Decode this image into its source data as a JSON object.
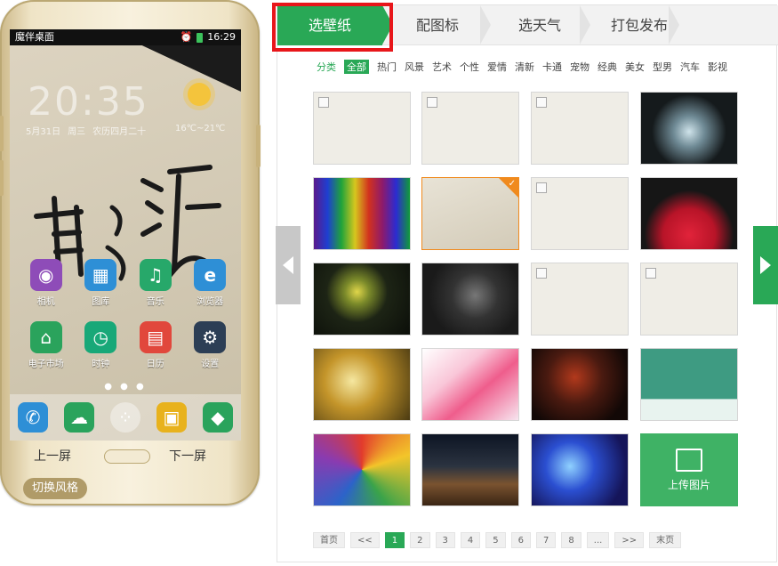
{
  "phone": {
    "status_title": "魔伴桌面",
    "status_time": "16:29",
    "clock": "20:35",
    "date_parts": [
      "5月31日",
      "周三",
      "农历四月二十"
    ],
    "temperature": "16℃~21℃",
    "apps": [
      {
        "label": "相机",
        "icon": "camera-icon",
        "color": "#8e4cb8",
        "glyph": "◉"
      },
      {
        "label": "图库",
        "icon": "gallery-icon",
        "color": "#2e8fd6",
        "glyph": "▦"
      },
      {
        "label": "音乐",
        "icon": "music-icon",
        "color": "#27a86a",
        "glyph": "♫"
      },
      {
        "label": "浏览器",
        "icon": "browser-icon",
        "color": "#2e8fd6",
        "glyph": "e"
      },
      {
        "label": "电子市场",
        "icon": "market-icon",
        "color": "#2aa35c",
        "glyph": "⌂"
      },
      {
        "label": "时钟",
        "icon": "alarm-clock-icon",
        "color": "#18a878",
        "glyph": "◷"
      },
      {
        "label": "日历",
        "icon": "calendar-icon",
        "color": "#e1473c",
        "glyph": "▤"
      },
      {
        "label": "设置",
        "icon": "settings-icon",
        "color": "#2c3e55",
        "glyph": "⚙"
      }
    ],
    "dock": [
      {
        "icon": "phone-icon",
        "color": "#2e8fd6",
        "glyph": "✆"
      },
      {
        "icon": "message-icon",
        "color": "#2aa35c",
        "glyph": "☁"
      },
      {
        "icon": "app-drawer-icon",
        "color": "rgba(255,255,255,0.4)",
        "glyph": "⁘"
      },
      {
        "icon": "contacts-icon",
        "color": "#e8b21d",
        "glyph": "▣"
      },
      {
        "icon": "theme-icon",
        "color": "#2aa35c",
        "glyph": "◆"
      }
    ],
    "prev_label": "上一屏",
    "next_label": "下一屏",
    "switch_style": "切换风格"
  },
  "steps": [
    {
      "label": "选壁纸",
      "active": true
    },
    {
      "label": "配图标",
      "active": false
    },
    {
      "label": "选天气",
      "active": false
    },
    {
      "label": "打包发布",
      "active": false
    }
  ],
  "filters": {
    "label": "分类",
    "items": [
      "全部",
      "热门",
      "风景",
      "艺术",
      "个性",
      "爱情",
      "清新",
      "卡通",
      "宠物",
      "经典",
      "美女",
      "型男",
      "汽车",
      "影视"
    ],
    "selected": "全部"
  },
  "wallpapers": [
    {
      "kind": "placeholder"
    },
    {
      "kind": "placeholder"
    },
    {
      "kind": "placeholder"
    },
    {
      "kind": "bottles"
    },
    {
      "kind": "spectrum"
    },
    {
      "kind": "calligraphy",
      "selected": true
    },
    {
      "kind": "placeholder"
    },
    {
      "kind": "couple"
    },
    {
      "kind": "lotus"
    },
    {
      "kind": "man"
    },
    {
      "kind": "placeholder"
    },
    {
      "kind": "placeholder"
    },
    {
      "kind": "silhouette"
    },
    {
      "kind": "flowers"
    },
    {
      "kind": "heart"
    },
    {
      "kind": "tree"
    },
    {
      "kind": "cartoon"
    },
    {
      "kind": "desert"
    },
    {
      "kind": "blue"
    },
    {
      "kind": "upload"
    }
  ],
  "upload_label": "上传图片",
  "pager": {
    "first": "首页",
    "prev": "<<",
    "pages": [
      "1",
      "2",
      "3",
      "4",
      "5",
      "6",
      "7",
      "8"
    ],
    "current": "1",
    "ellipsis": "...",
    "next": ">>",
    "last": "末页"
  },
  "colors": {
    "accent": "#29a856",
    "highlight": "#e8161a",
    "selected_border": "#f08a1d"
  }
}
